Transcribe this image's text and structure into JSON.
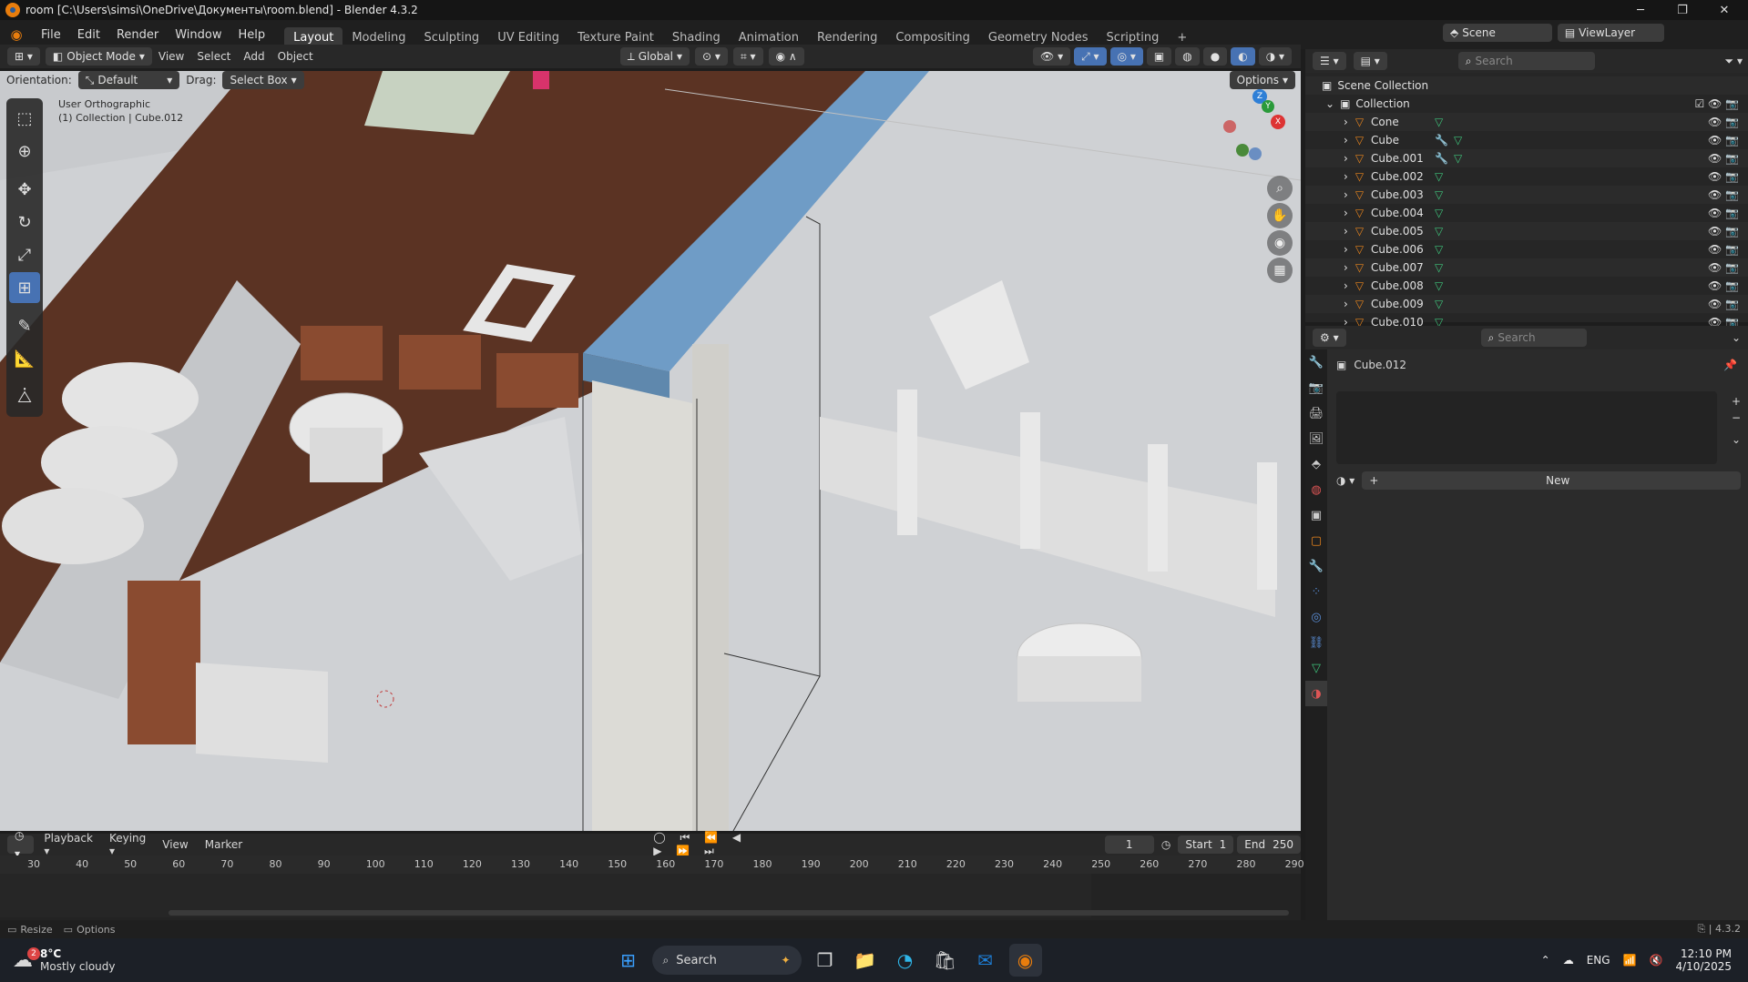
{
  "titlebar": {
    "title": "room [C:\\Users\\simsi\\OneDrive\\Документы\\room.blend] - Blender 4.3.2"
  },
  "menu": {
    "items": [
      "File",
      "Edit",
      "Render",
      "Window",
      "Help"
    ]
  },
  "workspaces": [
    "Layout",
    "Modeling",
    "Sculpting",
    "UV Editing",
    "Texture Paint",
    "Shading",
    "Animation",
    "Rendering",
    "Compositing",
    "Geometry Nodes",
    "Scripting"
  ],
  "scene": {
    "label": "Scene",
    "viewlayer": "ViewLayer"
  },
  "viewport_header": {
    "mode": "Object Mode",
    "menus": [
      "View",
      "Select",
      "Add",
      "Object"
    ],
    "transform": "Global"
  },
  "tool_settings": {
    "orientation_label": "Orientation:",
    "orientation_value": "Default",
    "drag_label": "Drag:",
    "drag_value": "Select Box",
    "options": "Options"
  },
  "viewport": {
    "view_name": "User Orthographic",
    "collection_info": "(1) Collection | Cube.012"
  },
  "outliner": {
    "search_placeholder": "Search",
    "root": "Scene Collection",
    "collection": "Collection",
    "objects": [
      "Cone",
      "Cube",
      "Cube.001",
      "Cube.002",
      "Cube.003",
      "Cube.004",
      "Cube.005",
      "Cube.006",
      "Cube.007",
      "Cube.008",
      "Cube.009",
      "Cube.010"
    ]
  },
  "properties": {
    "search_placeholder": "Search",
    "object_name": "Cube.012",
    "new_button": "New"
  },
  "timeline": {
    "menus": [
      "Playback",
      "Keying",
      "View",
      "Marker"
    ],
    "current_frame": "1",
    "start_label": "Start",
    "start_value": "1",
    "end_label": "End",
    "end_value": "250",
    "ticks": [
      "30",
      "40",
      "50",
      "60",
      "70",
      "80",
      "90",
      "100",
      "110",
      "120",
      "130",
      "140",
      "150",
      "160",
      "170",
      "180",
      "190",
      "200",
      "210",
      "220",
      "230",
      "240",
      "250",
      "260",
      "270",
      "280",
      "290"
    ]
  },
  "statusbar": {
    "resize": "Resize",
    "options": "Options",
    "version": "4.3.2"
  },
  "taskbar": {
    "weather_temp": "8°C",
    "weather_desc": "Mostly cloudy",
    "weather_badge": "2",
    "search": "Search",
    "lang": "ENG",
    "time": "12:10 PM",
    "date": "4/10/2025"
  }
}
